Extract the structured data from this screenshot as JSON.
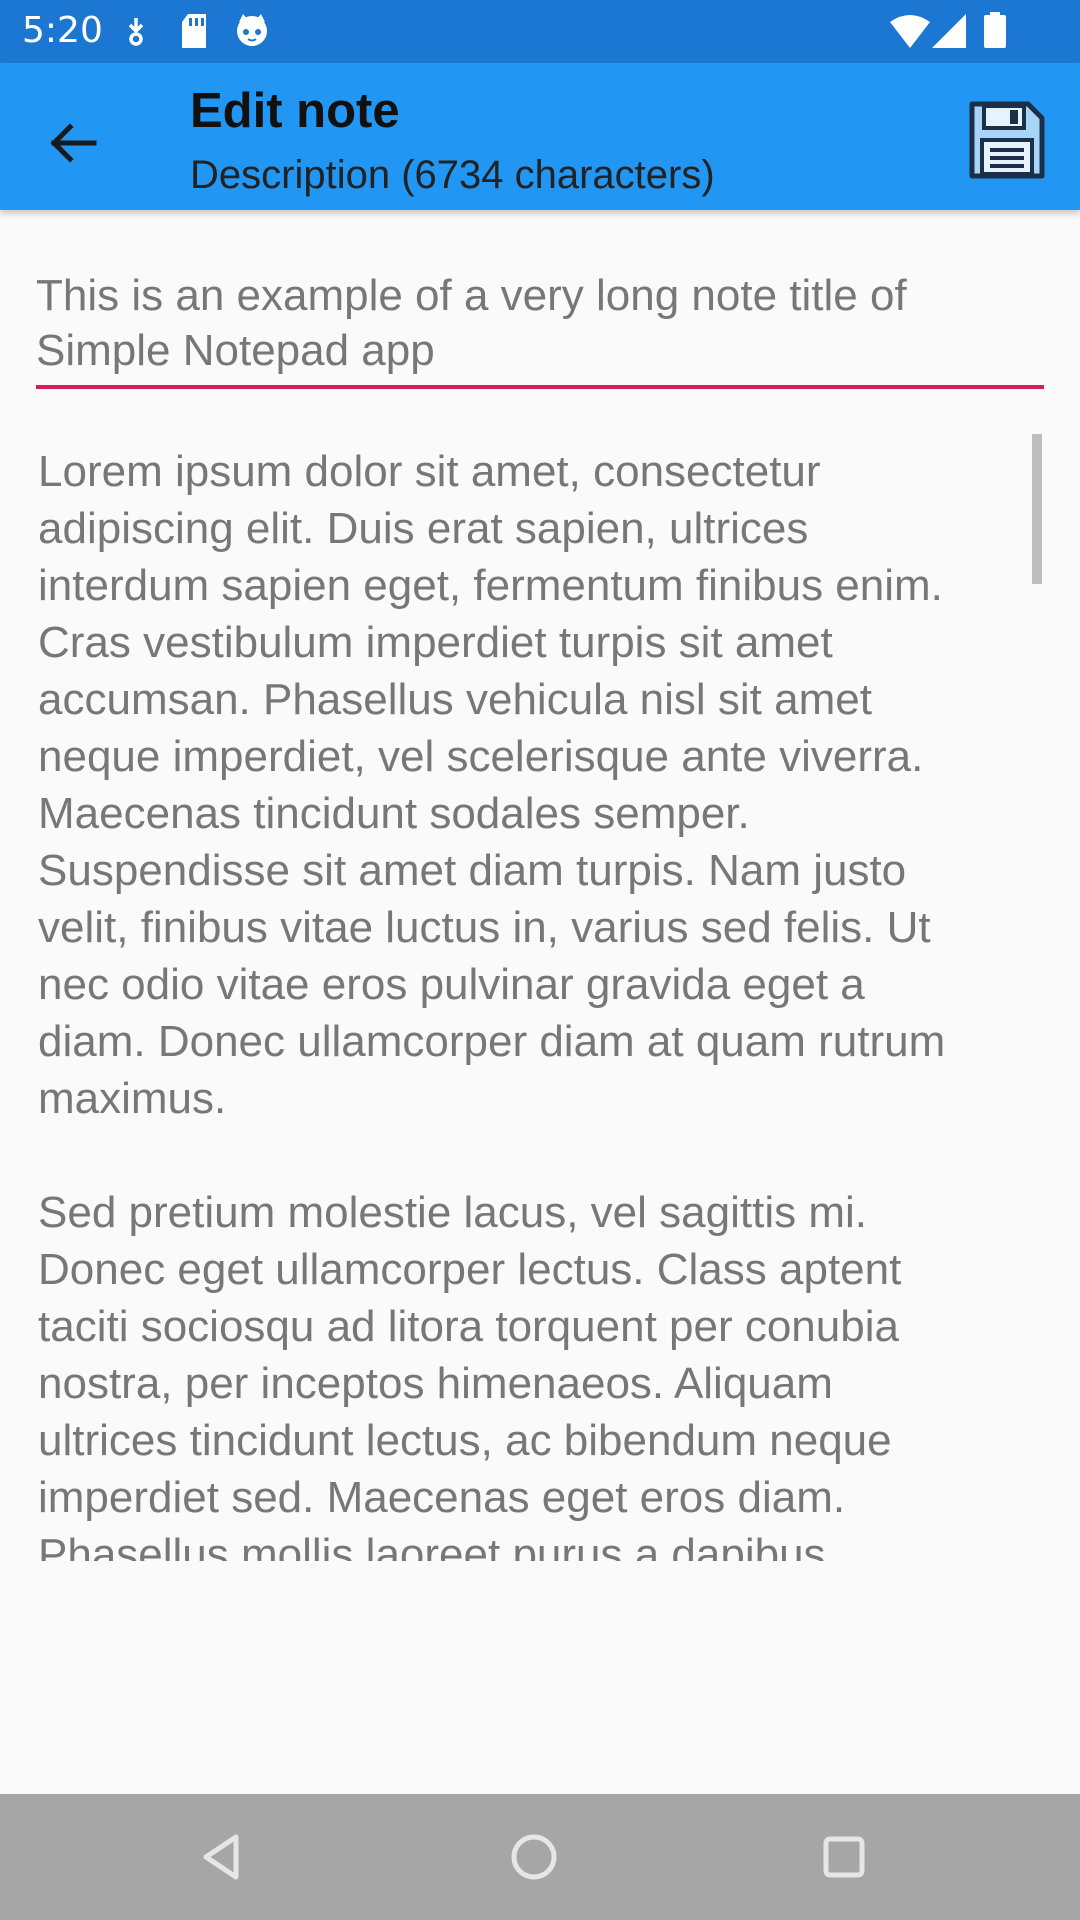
{
  "status_bar": {
    "time": "5:20",
    "left_icons": [
      "download-icon",
      "sd-card-icon",
      "cat-face-icon"
    ],
    "right_icons": [
      "wifi-icon",
      "cell-signal-icon",
      "battery-icon"
    ],
    "background": "#1c77d2"
  },
  "app_bar": {
    "back_icon": "arrow-back-icon",
    "title": "Edit note",
    "subtitle": "Description (6734 characters)",
    "save_icon": "floppy-disk-icon",
    "background": "#2196f3"
  },
  "editor": {
    "note_title": "This is an example of a very long note title of\nSimple Notepad app",
    "underline_color": "#d81b60",
    "note_body": "Lorem ipsum dolor sit amet, consectetur\nadipiscing elit. Duis erat sapien, ultrices\ninterdum sapien eget, fermentum finibus enim.\nCras vestibulum imperdiet turpis sit amet\naccumsan. Phasellus vehicula nisl sit amet\nneque imperdiet, vel scelerisque ante viverra.\nMaecenas tincidunt sodales semper.\nSuspendisse sit amet diam turpis. Nam justo\nvelit, finibus vitae luctus in, varius sed felis. Ut\nnec odio vitae eros pulvinar gravida eget a\ndiam. Donec ullamcorper diam at quam rutrum\nmaximus.\n\nSed pretium molestie lacus, vel sagittis mi.\nDonec eget ullamcorper lectus. Class aptent\ntaciti sociosqu ad litora torquent per conubia\nnostra, per inceptos himenaeos. Aliquam\nultrices tincidunt lectus, ac bibendum neque\nimperdiet sed. Maecenas eget eros diam.\nPhasellus mollis laoreet purus a dapibus.\nAenean vel orci lacus. Lorem ipsum dolor sit\namet, consectetur adipiscing elit. Ut eu lectus\naccumsan, laoreet tortor et, tincidunt purus."
  },
  "nav_bar": {
    "buttons": [
      "back-triangle-icon",
      "home-circle-icon",
      "recents-square-icon"
    ],
    "background": "#a6a6a6"
  }
}
